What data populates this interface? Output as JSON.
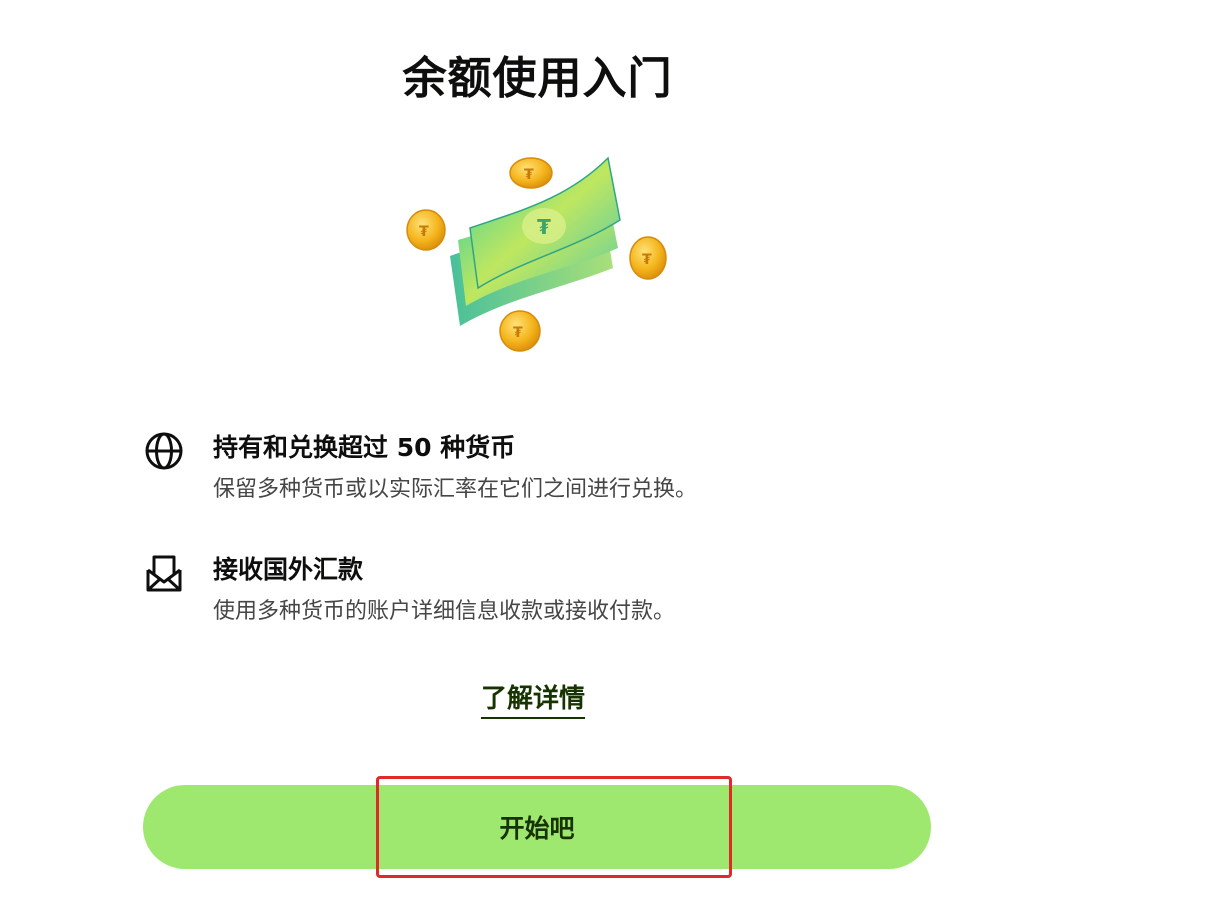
{
  "page": {
    "title": "余额使用入门"
  },
  "illustration": {
    "icon": "money-coins-illustration",
    "colors": {
      "bill": "#5fd39a",
      "bill_accent": "#c9e866",
      "coin": "#f2b51d",
      "coin_edge": "#d98e0b"
    }
  },
  "features": [
    {
      "icon": "globe-icon",
      "title": "持有和兑换超过 50 种货币",
      "description": "保留多种货币或以实际汇率在它们之间进行兑换。"
    },
    {
      "icon": "envelope-open-icon",
      "title": "接收国外汇款",
      "description": "使用多种货币的账户详细信息收款或接收付款。"
    }
  ],
  "actions": {
    "learn_more_label": "了解详情",
    "cta_label": "开始吧"
  },
  "colors": {
    "accent": "#9fe870",
    "accent_text": "#163300",
    "highlight": "#e02a2a"
  }
}
